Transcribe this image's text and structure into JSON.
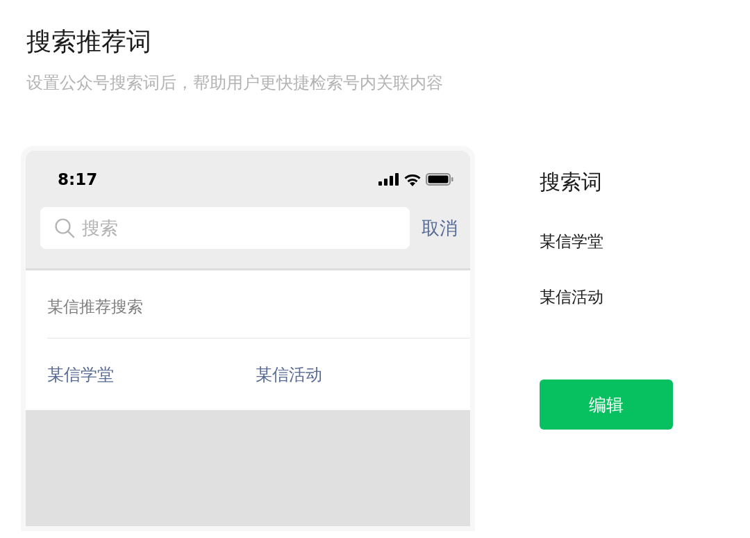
{
  "header": {
    "title": "搜索推荐词",
    "subtitle": "设置公众号搜索词后，帮助用户更快捷检索号内关联内容"
  },
  "phone": {
    "status_bar": {
      "time": "8:17"
    },
    "search": {
      "placeholder": "搜索",
      "cancel": "取消"
    },
    "recommend": {
      "heading": "某信推荐搜索",
      "items": [
        "某信学堂",
        "某信活动"
      ]
    }
  },
  "panel": {
    "title": "搜索词",
    "words": [
      "某信学堂",
      "某信活动"
    ],
    "button": "编辑"
  }
}
